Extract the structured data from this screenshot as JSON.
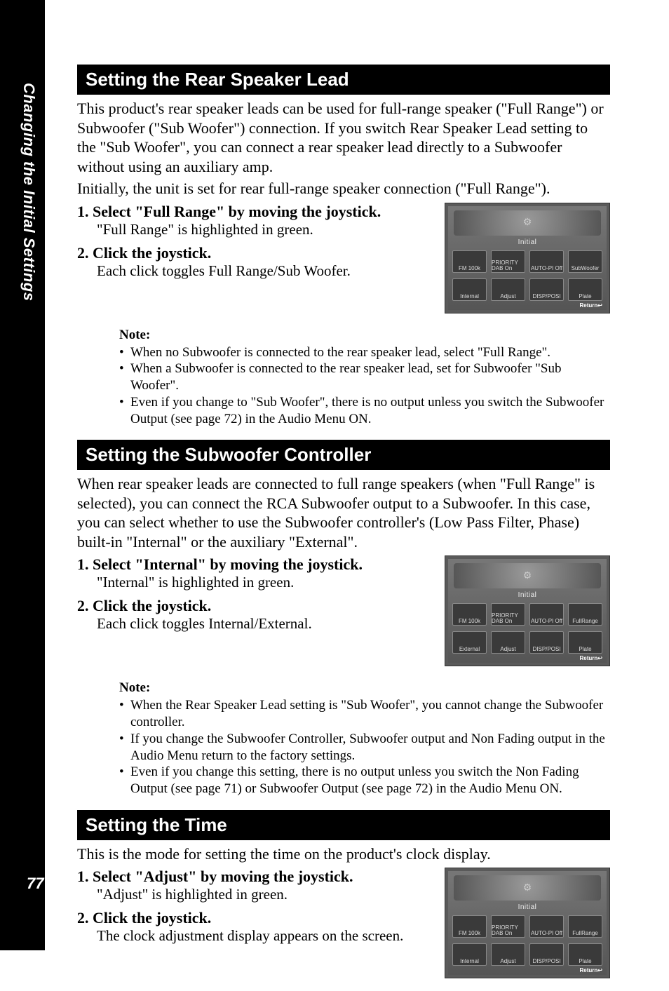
{
  "sidebar": {
    "chapter_label": "Changing the Initial Settings",
    "page_number": "77"
  },
  "sections": [
    {
      "title": "Setting the Rear Speaker Lead",
      "intro": "This product's rear speaker leads can be used for full-range speaker (\"Full Range\") or Subwoofer (\"Sub Woofer\") connection. If you switch Rear Speaker Lead setting to the \"Sub Woofer\", you can connect a rear speaker lead directly to a Subwoofer without using an auxiliary amp.",
      "intro2": "Initially, the unit is set for rear full-range speaker connection (\"Full Range\").",
      "steps": [
        {
          "num": "1.",
          "head": "Select \"Full Range\" by moving the joystick.",
          "sub": "\"Full Range\" is highlighted in green."
        },
        {
          "num": "2.",
          "head": "Click the joystick.",
          "sub": "Each click toggles Full Range/Sub Woofer."
        }
      ],
      "screenshot": {
        "title": "Initial",
        "row1": [
          "FM\n100k",
          "PRIORITY\nDAB On",
          "AUTO-PI\nOff",
          "SubWoofer"
        ],
        "row2": [
          "Internal",
          "Adjust",
          "DISP/POSI",
          "Plate"
        ],
        "return": "Return↩"
      },
      "note_title": "Note:",
      "notes": [
        "When no Subwoofer is connected to the rear speaker lead, select \"Full Range\".",
        "When a Subwoofer is connected to the rear speaker lead, set for Subwoofer \"Sub Woofer\".",
        "Even if you change to \"Sub Woofer\", there is no output unless you switch the Subwoofer Output (see page 72) in the Audio Menu ON."
      ]
    },
    {
      "title": "Setting the Subwoofer Controller",
      "intro": "When rear speaker leads are connected to full range speakers (when \"Full Range\" is selected), you can connect the RCA Subwoofer output to a Subwoofer. In this case, you can select whether to use the Subwoofer controller's (Low Pass Filter, Phase) built-in \"Internal\" or the auxiliary \"External\".",
      "steps": [
        {
          "num": "1.",
          "head": "Select \"Internal\" by moving the joystick.",
          "sub": "\"Internal\" is highlighted in green."
        },
        {
          "num": "2.",
          "head": "Click the joystick.",
          "sub": "Each click toggles Internal/External."
        }
      ],
      "screenshot": {
        "title": "Initial",
        "row1": [
          "FM\n100k",
          "PRIORITY\nDAB On",
          "AUTO-PI\nOff",
          "FullRange"
        ],
        "row2": [
          "External",
          "Adjust",
          "DISP/POSI",
          "Plate"
        ],
        "return": "Return↩"
      },
      "note_title": "Note:",
      "notes": [
        "When the Rear Speaker Lead setting is \"Sub Woofer\", you cannot change the Subwoofer controller.",
        "If you change the Subwoofer Controller, Subwoofer output and Non Fading output in the Audio Menu return to the factory settings.",
        "Even if you change this setting, there is no output unless you switch the Non Fading Output (see page 71) or Subwoofer Output (see page 72) in the Audio Menu ON."
      ]
    },
    {
      "title": "Setting the Time",
      "intro": "This is the mode for setting the time on the product's clock display.",
      "steps": [
        {
          "num": "1.",
          "head": "Select \"Adjust\" by moving the joystick.",
          "sub": "\"Adjust\" is highlighted in green."
        },
        {
          "num": "2.",
          "head": "Click the joystick.",
          "sub": "The clock adjustment display appears on the screen."
        }
      ],
      "screenshot": {
        "title": "Initial",
        "row1": [
          "FM\n100k",
          "PRIORITY\nDAB On",
          "AUTO-PI\nOff",
          "FullRange"
        ],
        "row2": [
          "Internal",
          "Adjust",
          "DISP/POSI",
          "Plate"
        ],
        "return": "Return↩"
      }
    }
  ]
}
